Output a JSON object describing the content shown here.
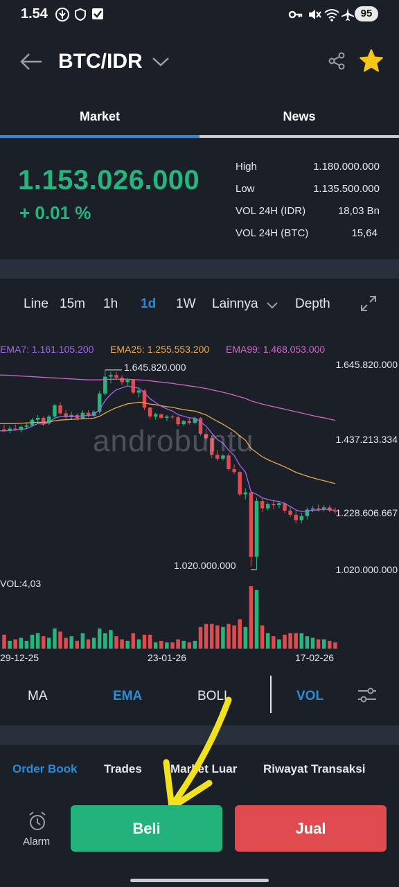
{
  "status": {
    "time": "1.54",
    "battery": "95"
  },
  "header": {
    "pair": "BTC/IDR"
  },
  "tabs": [
    {
      "label": "Market"
    },
    {
      "label": "News"
    }
  ],
  "price": {
    "current": "1.153.026.000",
    "change": "+ 0.01 %"
  },
  "stats": [
    {
      "label": "High",
      "value": "1.180.000.000"
    },
    {
      "label": "Low",
      "value": "1.135.500.000"
    },
    {
      "label": "VOL 24H (IDR)",
      "value": "18,03 Bn"
    },
    {
      "label": "VOL 24H (BTC)",
      "value": "15,64"
    }
  ],
  "timeframes": {
    "line": "Line",
    "m15": "15m",
    "h1": "1h",
    "d1": "1d",
    "w1": "1W",
    "more": "Lainnya",
    "depth": "Depth"
  },
  "chart_data": {
    "type": "candlestick",
    "ema": [
      {
        "name": "EMA7",
        "label": "EMA7: 1.161.105.200",
        "color": "#a266f0"
      },
      {
        "name": "EMA25",
        "label": "EMA25: 1.255.553.200",
        "color": "#e9a94a"
      },
      {
        "name": "EMA99",
        "label": "EMA99: 1.468.053.000",
        "color": "#d165c9"
      }
    ],
    "y_axis_labels": [
      "1.645.820.000",
      "1.437.213.334",
      "1.228.606.667",
      "1.020.000.000"
    ],
    "ylim": [
      1020000000,
      1645820000
    ],
    "high_marker": "1.645.820.000",
    "low_marker": "1.020.000.000",
    "volume_label": "VOL:4,03",
    "x_labels": [
      "29-12-25",
      "23-01-26",
      "17-02-26"
    ],
    "candles": [
      {
        "o": 1460,
        "h": 1475,
        "l": 1450,
        "c": 1455
      },
      {
        "o": 1455,
        "h": 1470,
        "l": 1448,
        "c": 1462
      },
      {
        "o": 1462,
        "h": 1475,
        "l": 1455,
        "c": 1458
      },
      {
        "o": 1458,
        "h": 1472,
        "l": 1450,
        "c": 1468
      },
      {
        "o": 1468,
        "h": 1480,
        "l": 1460,
        "c": 1472
      },
      {
        "o": 1472,
        "h": 1495,
        "l": 1468,
        "c": 1490
      },
      {
        "o": 1490,
        "h": 1505,
        "l": 1480,
        "c": 1496
      },
      {
        "o": 1496,
        "h": 1500,
        "l": 1470,
        "c": 1478
      },
      {
        "o": 1478,
        "h": 1505,
        "l": 1474,
        "c": 1500
      },
      {
        "o": 1500,
        "h": 1540,
        "l": 1495,
        "c": 1535
      },
      {
        "o": 1535,
        "h": 1545,
        "l": 1505,
        "c": 1510
      },
      {
        "o": 1510,
        "h": 1520,
        "l": 1490,
        "c": 1498
      },
      {
        "o": 1498,
        "h": 1515,
        "l": 1490,
        "c": 1505
      },
      {
        "o": 1505,
        "h": 1510,
        "l": 1488,
        "c": 1495
      },
      {
        "o": 1495,
        "h": 1520,
        "l": 1492,
        "c": 1512
      },
      {
        "o": 1512,
        "h": 1520,
        "l": 1498,
        "c": 1502
      },
      {
        "o": 1502,
        "h": 1520,
        "l": 1500,
        "c": 1515
      },
      {
        "o": 1515,
        "h": 1580,
        "l": 1508,
        "c": 1572
      },
      {
        "o": 1572,
        "h": 1646,
        "l": 1565,
        "c": 1625
      },
      {
        "o": 1625,
        "h": 1640,
        "l": 1605,
        "c": 1630
      },
      {
        "o": 1630,
        "h": 1640,
        "l": 1615,
        "c": 1622
      },
      {
        "o": 1622,
        "h": 1630,
        "l": 1600,
        "c": 1608
      },
      {
        "o": 1608,
        "h": 1620,
        "l": 1598,
        "c": 1615
      },
      {
        "o": 1615,
        "h": 1618,
        "l": 1570,
        "c": 1575
      },
      {
        "o": 1575,
        "h": 1588,
        "l": 1560,
        "c": 1582
      },
      {
        "o": 1582,
        "h": 1585,
        "l": 1520,
        "c": 1528
      },
      {
        "o": 1528,
        "h": 1530,
        "l": 1492,
        "c": 1500
      },
      {
        "o": 1500,
        "h": 1512,
        "l": 1490,
        "c": 1507
      },
      {
        "o": 1507,
        "h": 1510,
        "l": 1492,
        "c": 1496
      },
      {
        "o": 1496,
        "h": 1505,
        "l": 1485,
        "c": 1500
      },
      {
        "o": 1500,
        "h": 1506,
        "l": 1492,
        "c": 1498
      },
      {
        "o": 1498,
        "h": 1502,
        "l": 1470,
        "c": 1476
      },
      {
        "o": 1476,
        "h": 1490,
        "l": 1470,
        "c": 1486
      },
      {
        "o": 1486,
        "h": 1495,
        "l": 1475,
        "c": 1480
      },
      {
        "o": 1480,
        "h": 1500,
        "l": 1476,
        "c": 1495
      },
      {
        "o": 1495,
        "h": 1498,
        "l": 1440,
        "c": 1446
      },
      {
        "o": 1446,
        "h": 1462,
        "l": 1425,
        "c": 1432
      },
      {
        "o": 1432,
        "h": 1440,
        "l": 1370,
        "c": 1380
      },
      {
        "o": 1380,
        "h": 1395,
        "l": 1360,
        "c": 1368
      },
      {
        "o": 1368,
        "h": 1382,
        "l": 1362,
        "c": 1378
      },
      {
        "o": 1378,
        "h": 1385,
        "l": 1330,
        "c": 1335
      },
      {
        "o": 1335,
        "h": 1350,
        "l": 1320,
        "c": 1326
      },
      {
        "o": 1326,
        "h": 1330,
        "l": 1250,
        "c": 1256
      },
      {
        "o": 1256,
        "h": 1275,
        "l": 1240,
        "c": 1262
      },
      {
        "o": 1262,
        "h": 1268,
        "l": 1030,
        "c": 1060
      },
      {
        "o": 1060,
        "h": 1245,
        "l": 1020,
        "c": 1235
      },
      {
        "o": 1235,
        "h": 1245,
        "l": 1200,
        "c": 1212
      },
      {
        "o": 1212,
        "h": 1230,
        "l": 1205,
        "c": 1226
      },
      {
        "o": 1226,
        "h": 1238,
        "l": 1210,
        "c": 1222
      },
      {
        "o": 1222,
        "h": 1232,
        "l": 1212,
        "c": 1228
      },
      {
        "o": 1228,
        "h": 1232,
        "l": 1198,
        "c": 1205
      },
      {
        "o": 1205,
        "h": 1218,
        "l": 1185,
        "c": 1192
      },
      {
        "o": 1192,
        "h": 1205,
        "l": 1165,
        "c": 1175
      },
      {
        "o": 1175,
        "h": 1198,
        "l": 1165,
        "c": 1188
      },
      {
        "o": 1188,
        "h": 1215,
        "l": 1178,
        "c": 1208
      },
      {
        "o": 1208,
        "h": 1220,
        "l": 1200,
        "c": 1212
      },
      {
        "o": 1212,
        "h": 1225,
        "l": 1202,
        "c": 1208
      },
      {
        "o": 1208,
        "h": 1222,
        "l": 1202,
        "c": 1215
      },
      {
        "o": 1215,
        "h": 1222,
        "l": 1200,
        "c": 1205
      },
      {
        "o": 1205,
        "h": 1215,
        "l": 1196,
        "c": 1202
      }
    ],
    "ema7": [
      1455,
      1456,
      1458,
      1460,
      1462,
      1470,
      1478,
      1476,
      1482,
      1495,
      1500,
      1500,
      1501,
      1500,
      1503,
      1503,
      1506,
      1522,
      1550,
      1570,
      1584,
      1590,
      1596,
      1592,
      1589,
      1574,
      1556,
      1544,
      1532,
      1524,
      1517,
      1506,
      1501,
      1496,
      1495,
      1483,
      1470,
      1448,
      1428,
      1416,
      1395,
      1378,
      1347,
      1326,
      1264,
      1256,
      1245,
      1240,
      1236,
      1234,
      1227,
      1218,
      1207,
      1202,
      1204,
      1206,
      1207,
      1209,
      1208,
      1206
    ],
    "ema25": [
      1478,
      1478,
      1478,
      1479,
      1480,
      1481,
      1482,
      1482,
      1483,
      1487,
      1489,
      1490,
      1491,
      1492,
      1493,
      1494,
      1495,
      1501,
      1511,
      1520,
      1528,
      1534,
      1540,
      1542,
      1545,
      1543,
      1539,
      1537,
      1534,
      1531,
      1529,
      1525,
      1522,
      1519,
      1517,
      1511,
      1505,
      1495,
      1485,
      1476,
      1465,
      1454,
      1439,
      1426,
      1400,
      1387,
      1374,
      1365,
      1357,
      1350,
      1342,
      1334,
      1325,
      1319,
      1313,
      1308,
      1303,
      1299,
      1294,
      1290
    ],
    "ema99": [
      1630,
      1629,
      1628,
      1627,
      1626,
      1625,
      1624,
      1623,
      1622,
      1621,
      1620,
      1619,
      1618,
      1617,
      1616,
      1615,
      1615,
      1615,
      1616,
      1617,
      1617,
      1617,
      1617,
      1616,
      1615,
      1614,
      1612,
      1610,
      1608,
      1606,
      1604,
      1601,
      1599,
      1596,
      1594,
      1591,
      1588,
      1584,
      1580,
      1576,
      1572,
      1567,
      1562,
      1557,
      1549,
      1544,
      1539,
      1535,
      1531,
      1527,
      1523,
      1519,
      1515,
      1511,
      1507,
      1503,
      1499,
      1496,
      1492,
      1488
    ],
    "volumes": [
      0.9,
      0.5,
      0.6,
      0.7,
      0.5,
      0.9,
      1.0,
      0.8,
      0.7,
      1.3,
      1.1,
      0.7,
      0.8,
      0.5,
      1.0,
      0.6,
      0.7,
      1.3,
      1.0,
      1.2,
      0.8,
      0.6,
      0.5,
      1.0,
      0.6,
      0.9,
      0.9,
      0.4,
      0.5,
      0.4,
      0.4,
      0.6,
      0.5,
      0.4,
      0.5,
      1.4,
      1.6,
      1.6,
      1.5,
      1.4,
      1.6,
      1.5,
      1.9,
      1.4,
      4.03,
      3.8,
      1.5,
      1.0,
      0.8,
      0.6,
      0.9,
      1.0,
      1.0,
      1.0,
      0.8,
      0.7,
      0.6,
      0.6,
      0.5,
      0.4
    ]
  },
  "watermark": "androbuntu",
  "indicators": {
    "ma": "MA",
    "ema": "EMA",
    "boll": "BOLL",
    "vol": "VOL"
  },
  "bottom_tabs": [
    {
      "label": "Order Book"
    },
    {
      "label": "Trades"
    },
    {
      "label": "Market Luar"
    },
    {
      "label": "Riwayat Transaksi"
    }
  ],
  "actions": {
    "alarm": "Alarm",
    "buy": "Beli",
    "sell": "Jual"
  },
  "colors": {
    "accent": "#2d8ad4",
    "up": "#26b57c",
    "down": "#e04b4f",
    "bg": "#1b2028"
  }
}
